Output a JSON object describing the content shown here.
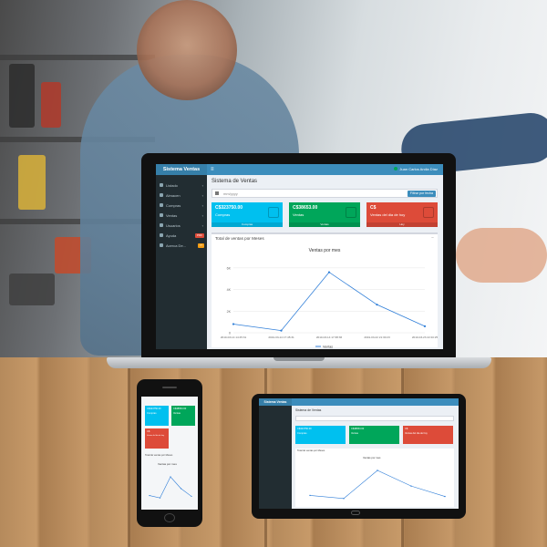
{
  "app": {
    "brand": "Sistema Ventas",
    "menu_icon": "≡",
    "user": "Juan Carlos Arcila Díaz"
  },
  "sidebar": {
    "items": [
      {
        "label": "Listado",
        "icon": "list-icon"
      },
      {
        "label": "Almacen",
        "icon": "box-icon"
      },
      {
        "label": "Compras",
        "icon": "cart-icon"
      },
      {
        "label": "Ventas",
        "icon": "receipt-icon"
      },
      {
        "label": "Usuarios",
        "icon": "users-icon"
      },
      {
        "label": "Ayuda",
        "icon": "help-icon",
        "badge": "PDF"
      },
      {
        "label": "Acerca De...",
        "icon": "info-icon",
        "badge": "IT"
      }
    ]
  },
  "page": {
    "title": "Sistema de Ventas",
    "date_placeholder": "mm/yyyy",
    "filter_button": "Filtrar por fecha"
  },
  "kpis": [
    {
      "value": "C$323750.00",
      "label": "Compras",
      "footer": "Compras",
      "color": "#00c0ef"
    },
    {
      "value": "C$38653.00",
      "label": "Ventas",
      "footer": "Ventas",
      "color": "#00a65a"
    },
    {
      "value": "C$",
      "label": "Ventas del dia de hoy",
      "footer": "Hoy",
      "color": "#dd4b39"
    }
  ],
  "chart_panel": {
    "header": "Total de ventas por Meses",
    "minimize": "−"
  },
  "chart_data": {
    "type": "line",
    "title": "Ventas por mes",
    "x": [
      "2019-03-14 14:45:31",
      "2019-03-14 17:45:31",
      "2019-03-14 17:38:36",
      "2019-03-22 21:30:23",
      "2019-03-23 22:20:25"
    ],
    "series": [
      {
        "name": "Ventas",
        "values": [
          800,
          200,
          5600,
          2600,
          600
        ]
      }
    ],
    "ylim": [
      0,
      7000
    ],
    "yticks": [
      "0",
      "2K",
      "4K",
      "6K"
    ],
    "ylabel": "",
    "grid": true,
    "line_color": "#2f7ed8"
  },
  "devices": {
    "phone": {
      "kpis": [
        {
          "value": "C$323750.00",
          "label": "Compras",
          "color": "#00c0ef"
        },
        {
          "value": "C$38653.00",
          "label": "Ventas",
          "color": "#00a65a"
        },
        {
          "value": "C$",
          "label": "Ventas del dia de hoy",
          "color": "#dd4b39"
        }
      ],
      "chart_header": "Total de ventas por Meses",
      "chart_title": "Ventas por mes"
    },
    "tablet": {
      "brand": "Sistema Ventas",
      "title": "Sistema de Ventas",
      "kpis": [
        {
          "value": "C$323750.00",
          "label": "Compras",
          "color": "#00c0ef"
        },
        {
          "value": "C$38653.00",
          "label": "Ventas",
          "color": "#00a65a"
        },
        {
          "value": "C$",
          "label": "Ventas del dia de hoy",
          "color": "#dd4b39"
        }
      ],
      "chart_header": "Total de ventas por Meses",
      "chart_title": "Ventas por mes"
    }
  }
}
